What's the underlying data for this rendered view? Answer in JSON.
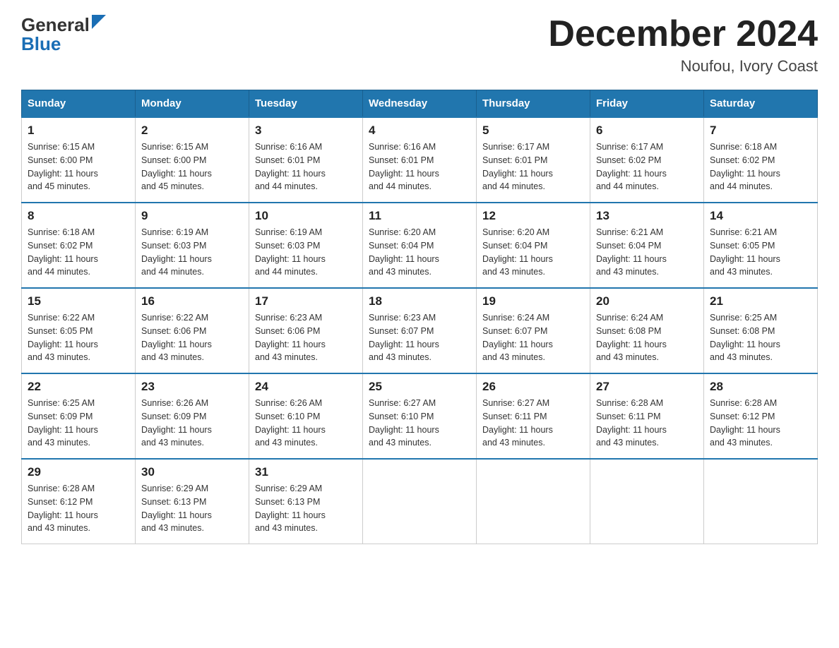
{
  "logo": {
    "line1": "General",
    "line2": "Blue"
  },
  "title": "December 2024",
  "subtitle": "Noufou, Ivory Coast",
  "days_of_week": [
    "Sunday",
    "Monday",
    "Tuesday",
    "Wednesday",
    "Thursday",
    "Friday",
    "Saturday"
  ],
  "weeks": [
    [
      {
        "day": "1",
        "sunrise": "6:15 AM",
        "sunset": "6:00 PM",
        "daylight": "11 hours and 45 minutes."
      },
      {
        "day": "2",
        "sunrise": "6:15 AM",
        "sunset": "6:00 PM",
        "daylight": "11 hours and 45 minutes."
      },
      {
        "day": "3",
        "sunrise": "6:16 AM",
        "sunset": "6:01 PM",
        "daylight": "11 hours and 44 minutes."
      },
      {
        "day": "4",
        "sunrise": "6:16 AM",
        "sunset": "6:01 PM",
        "daylight": "11 hours and 44 minutes."
      },
      {
        "day": "5",
        "sunrise": "6:17 AM",
        "sunset": "6:01 PM",
        "daylight": "11 hours and 44 minutes."
      },
      {
        "day": "6",
        "sunrise": "6:17 AM",
        "sunset": "6:02 PM",
        "daylight": "11 hours and 44 minutes."
      },
      {
        "day": "7",
        "sunrise": "6:18 AM",
        "sunset": "6:02 PM",
        "daylight": "11 hours and 44 minutes."
      }
    ],
    [
      {
        "day": "8",
        "sunrise": "6:18 AM",
        "sunset": "6:02 PM",
        "daylight": "11 hours and 44 minutes."
      },
      {
        "day": "9",
        "sunrise": "6:19 AM",
        "sunset": "6:03 PM",
        "daylight": "11 hours and 44 minutes."
      },
      {
        "day": "10",
        "sunrise": "6:19 AM",
        "sunset": "6:03 PM",
        "daylight": "11 hours and 44 minutes."
      },
      {
        "day": "11",
        "sunrise": "6:20 AM",
        "sunset": "6:04 PM",
        "daylight": "11 hours and 43 minutes."
      },
      {
        "day": "12",
        "sunrise": "6:20 AM",
        "sunset": "6:04 PM",
        "daylight": "11 hours and 43 minutes."
      },
      {
        "day": "13",
        "sunrise": "6:21 AM",
        "sunset": "6:04 PM",
        "daylight": "11 hours and 43 minutes."
      },
      {
        "day": "14",
        "sunrise": "6:21 AM",
        "sunset": "6:05 PM",
        "daylight": "11 hours and 43 minutes."
      }
    ],
    [
      {
        "day": "15",
        "sunrise": "6:22 AM",
        "sunset": "6:05 PM",
        "daylight": "11 hours and 43 minutes."
      },
      {
        "day": "16",
        "sunrise": "6:22 AM",
        "sunset": "6:06 PM",
        "daylight": "11 hours and 43 minutes."
      },
      {
        "day": "17",
        "sunrise": "6:23 AM",
        "sunset": "6:06 PM",
        "daylight": "11 hours and 43 minutes."
      },
      {
        "day": "18",
        "sunrise": "6:23 AM",
        "sunset": "6:07 PM",
        "daylight": "11 hours and 43 minutes."
      },
      {
        "day": "19",
        "sunrise": "6:24 AM",
        "sunset": "6:07 PM",
        "daylight": "11 hours and 43 minutes."
      },
      {
        "day": "20",
        "sunrise": "6:24 AM",
        "sunset": "6:08 PM",
        "daylight": "11 hours and 43 minutes."
      },
      {
        "day": "21",
        "sunrise": "6:25 AM",
        "sunset": "6:08 PM",
        "daylight": "11 hours and 43 minutes."
      }
    ],
    [
      {
        "day": "22",
        "sunrise": "6:25 AM",
        "sunset": "6:09 PM",
        "daylight": "11 hours and 43 minutes."
      },
      {
        "day": "23",
        "sunrise": "6:26 AM",
        "sunset": "6:09 PM",
        "daylight": "11 hours and 43 minutes."
      },
      {
        "day": "24",
        "sunrise": "6:26 AM",
        "sunset": "6:10 PM",
        "daylight": "11 hours and 43 minutes."
      },
      {
        "day": "25",
        "sunrise": "6:27 AM",
        "sunset": "6:10 PM",
        "daylight": "11 hours and 43 minutes."
      },
      {
        "day": "26",
        "sunrise": "6:27 AM",
        "sunset": "6:11 PM",
        "daylight": "11 hours and 43 minutes."
      },
      {
        "day": "27",
        "sunrise": "6:28 AM",
        "sunset": "6:11 PM",
        "daylight": "11 hours and 43 minutes."
      },
      {
        "day": "28",
        "sunrise": "6:28 AM",
        "sunset": "6:12 PM",
        "daylight": "11 hours and 43 minutes."
      }
    ],
    [
      {
        "day": "29",
        "sunrise": "6:28 AM",
        "sunset": "6:12 PM",
        "daylight": "11 hours and 43 minutes."
      },
      {
        "day": "30",
        "sunrise": "6:29 AM",
        "sunset": "6:13 PM",
        "daylight": "11 hours and 43 minutes."
      },
      {
        "day": "31",
        "sunrise": "6:29 AM",
        "sunset": "6:13 PM",
        "daylight": "11 hours and 43 minutes."
      },
      null,
      null,
      null,
      null
    ]
  ],
  "labels": {
    "sunrise": "Sunrise:",
    "sunset": "Sunset:",
    "daylight": "Daylight:"
  }
}
